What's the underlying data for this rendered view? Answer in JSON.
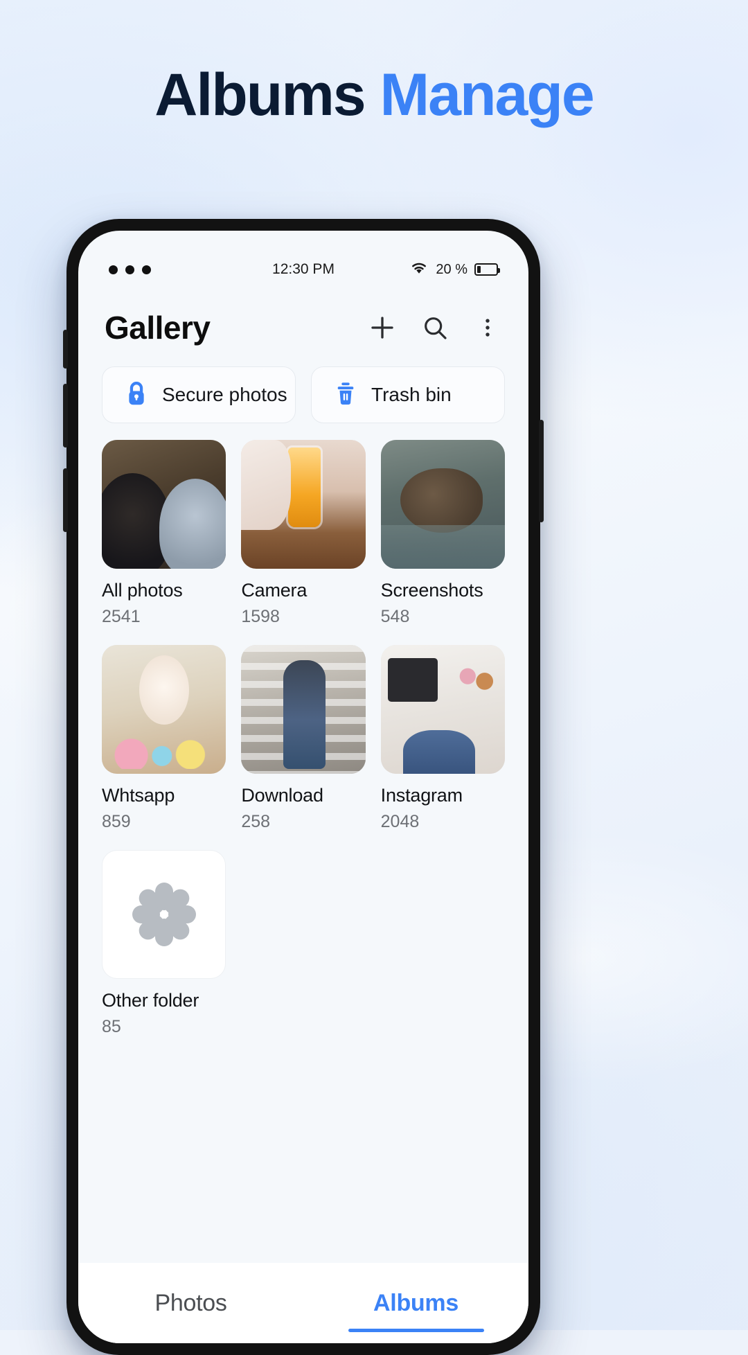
{
  "headline": {
    "word_dark": "Albums",
    "word_blue": "Manage",
    "color_dark": "#0b1b33",
    "color_blue": "#3b82f6"
  },
  "status_bar": {
    "time": "12:30 PM",
    "battery_text": "20 %",
    "battery_level_pct": 20,
    "wifi_icon": "wifi-icon",
    "dots_icon": "three-dots-icon"
  },
  "app": {
    "title": "Gallery",
    "actions": [
      {
        "name": "add-button",
        "icon": "plus-icon"
      },
      {
        "name": "search-button",
        "icon": "search-icon"
      },
      {
        "name": "more-button",
        "icon": "kebab-menu-icon"
      }
    ],
    "quick_actions": [
      {
        "label": "Secure photos",
        "icon": "lock-icon",
        "color": "#3b82f6"
      },
      {
        "label": "Trash bin",
        "icon": "trash-icon",
        "color": "#3b82f6"
      }
    ],
    "albums": [
      {
        "name": "All photos",
        "count": "2541",
        "art": "ph-couple"
      },
      {
        "name": "Camera",
        "count": "1598",
        "art": "ph-beer"
      },
      {
        "name": "Screenshots",
        "count": "548",
        "art": "ph-otter"
      },
      {
        "name": "Whtsapp",
        "count": "859",
        "art": "ph-bunny"
      },
      {
        "name": "Download",
        "count": "258",
        "art": "ph-stairs"
      },
      {
        "name": "Instagram",
        "count": "2048",
        "art": "ph-flat"
      },
      {
        "name": "Other folder",
        "count": "85",
        "art": "placeholder"
      }
    ],
    "tabs": [
      {
        "label": "Photos",
        "active": false
      },
      {
        "label": "Albums",
        "active": true
      }
    ]
  }
}
